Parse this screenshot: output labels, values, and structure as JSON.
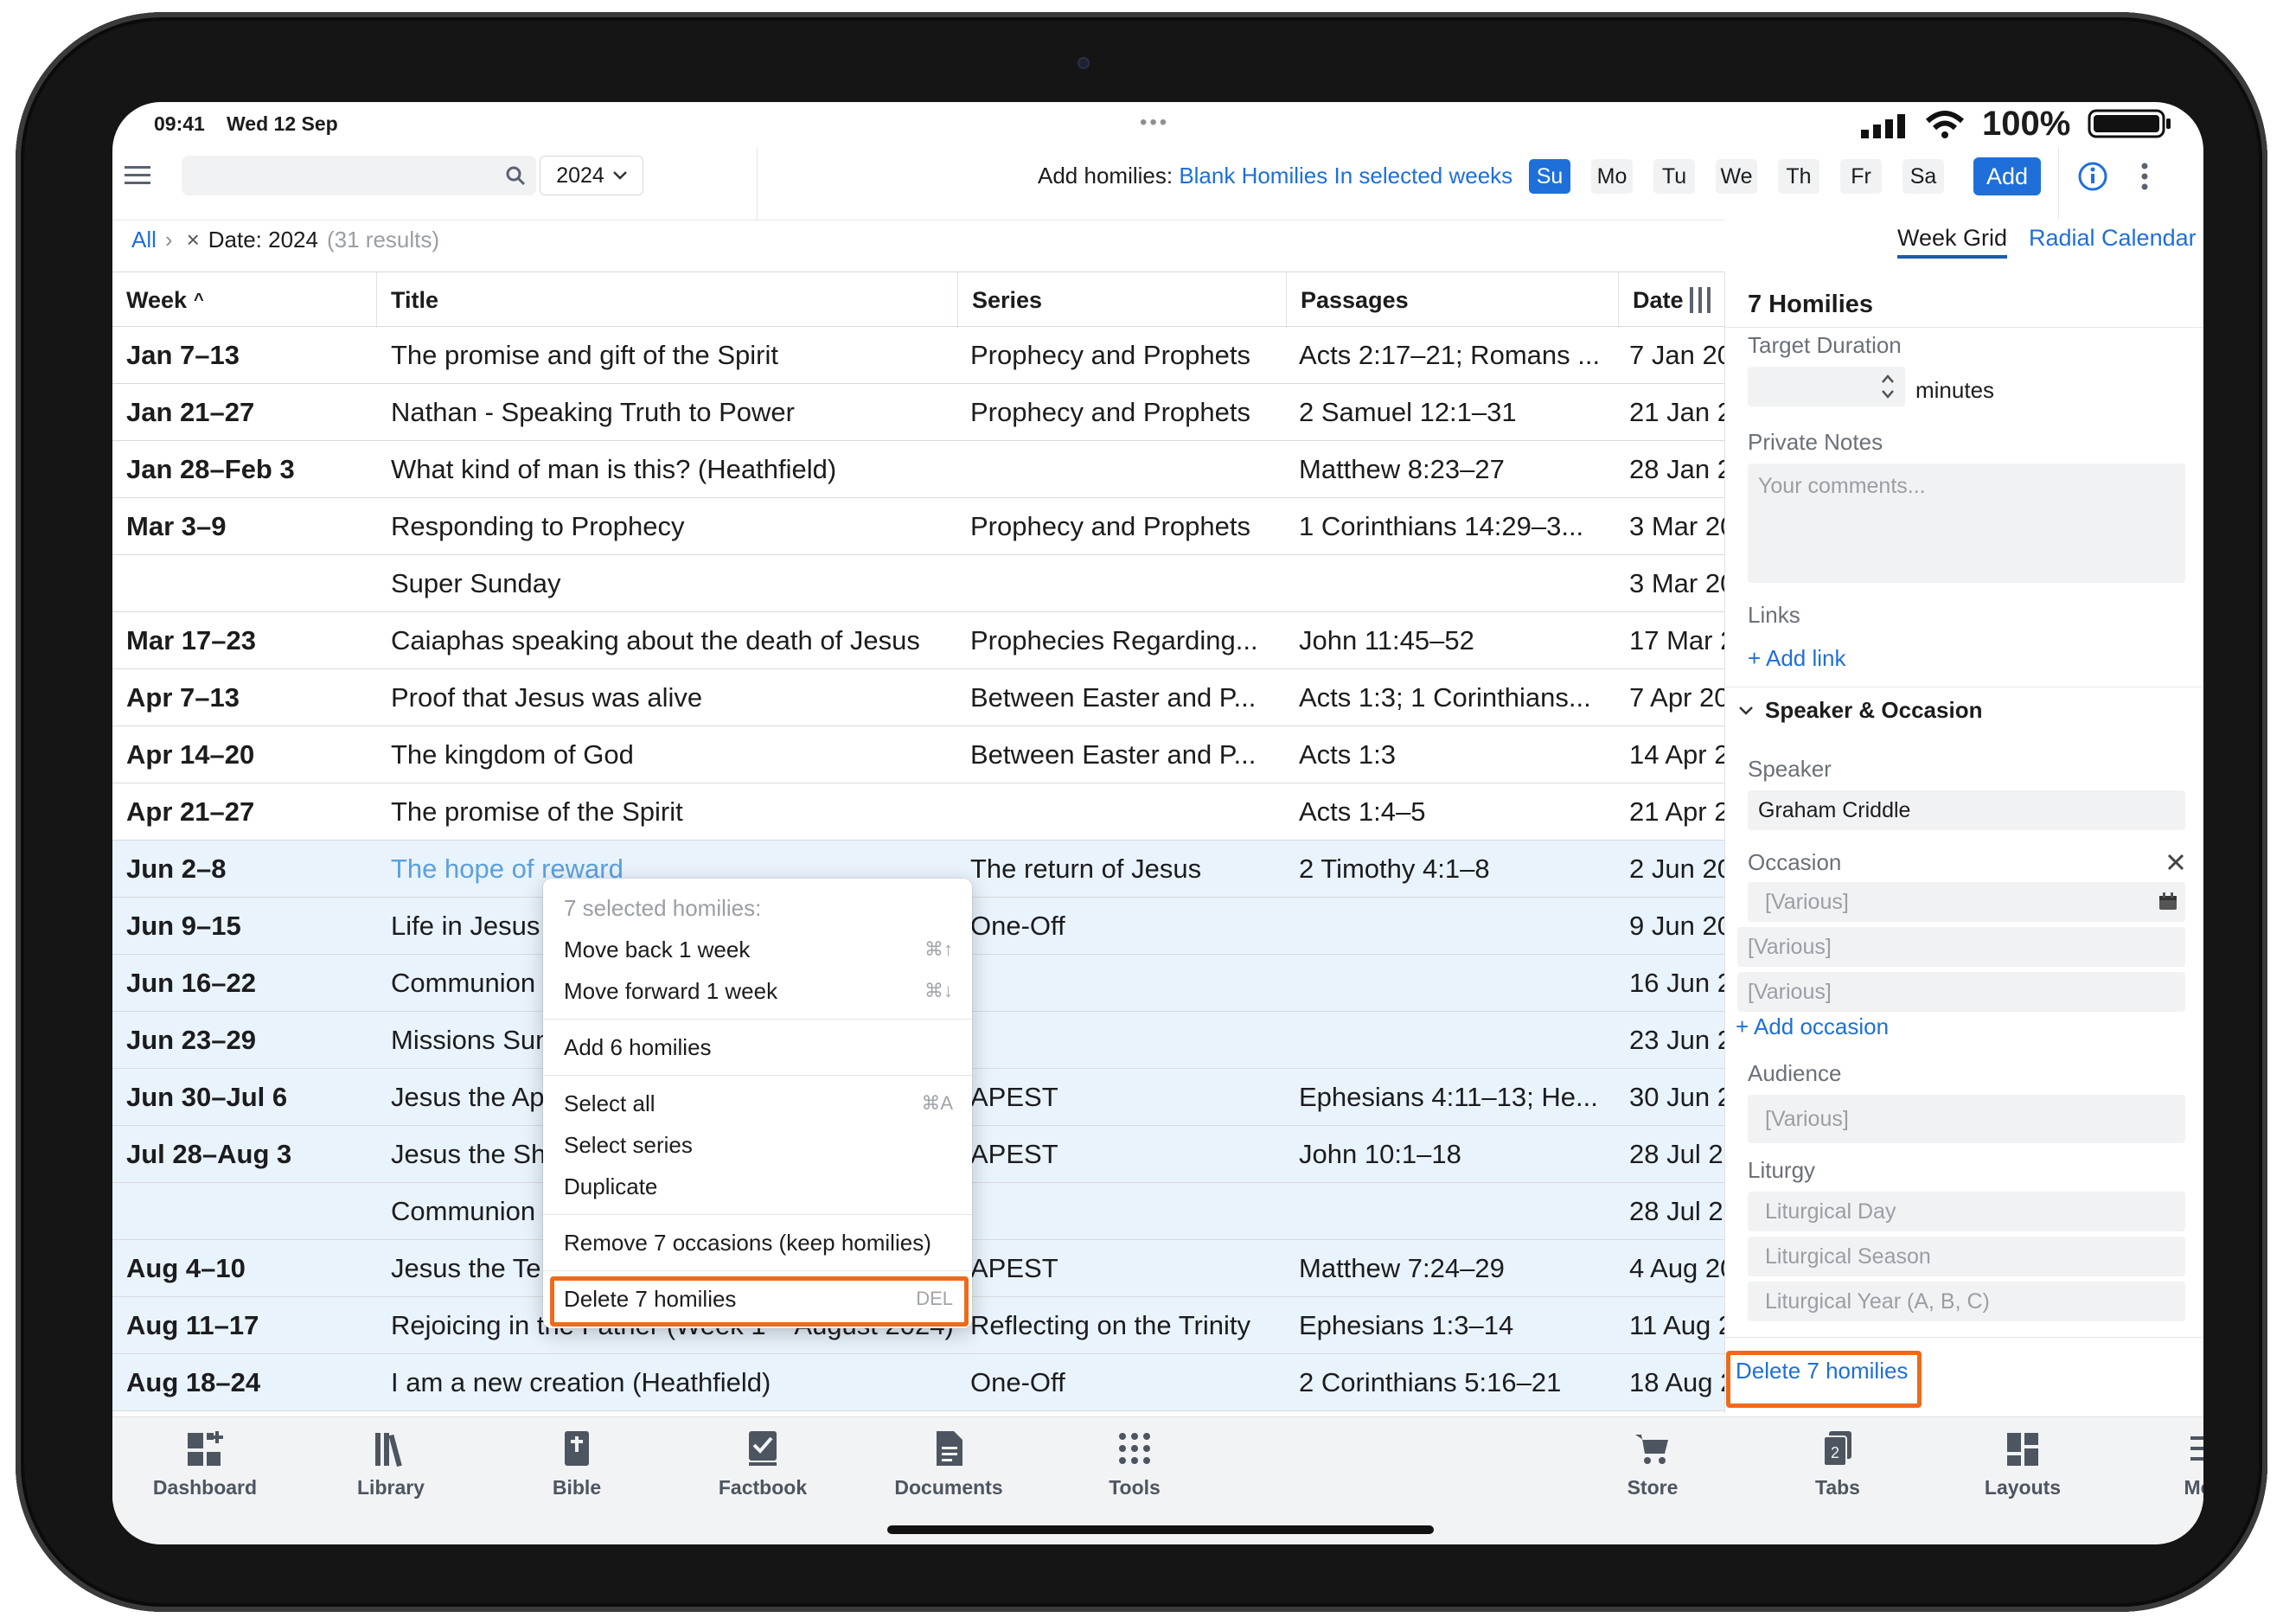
{
  "status": {
    "time": "09:41",
    "date": "Wed 12 Sep",
    "battery": "100%"
  },
  "toolbar": {
    "year": "2024",
    "add_label": "Add homilies:",
    "blank_link": "Blank Homilies",
    "weeks_link": "In selected weeks",
    "days": [
      "Su",
      "Mo",
      "Tu",
      "We",
      "Th",
      "Fr",
      "Sa"
    ],
    "add_button": "Add"
  },
  "filter": {
    "all": "All",
    "chevron": "›",
    "remove": "×",
    "date": "Date: 2024",
    "results": "(31 results)"
  },
  "views": {
    "week_grid": "Week Grid",
    "radial": "Radial Calendar"
  },
  "table": {
    "headers": {
      "week": "Week",
      "title": "Title",
      "series": "Series",
      "passages": "Passages",
      "date": "Date"
    },
    "rows": [
      {
        "week": "Jan 7–13",
        "title": "The promise and gift of the Spirit",
        "series": "Prophecy and Prophets",
        "passages": "Acts 2:17–21; Romans ...",
        "date": "7 Jan 20"
      },
      {
        "week": "Jan 21–27",
        "title": "Nathan - Speaking Truth to Power",
        "series": "Prophecy and Prophets",
        "passages": "2 Samuel 12:1–31",
        "date": "21 Jan 2"
      },
      {
        "week": "Jan 28–Feb 3",
        "title": "What kind of man is this? (Heathfield)",
        "series": "",
        "passages": "Matthew 8:23–27",
        "date": "28 Jan 2"
      },
      {
        "week": "Mar 3–9",
        "title": "Responding to Prophecy",
        "series": "Prophecy and Prophets",
        "passages": "1 Corinthians 14:29–3...",
        "date": "3 Mar 20"
      },
      {
        "week": "",
        "title": "Super Sunday",
        "series": "",
        "passages": "",
        "date": "3 Mar 20"
      },
      {
        "week": "Mar 17–23",
        "title": "Caiaphas speaking about the death of Jesus",
        "series": "Prophecies Regarding...",
        "passages": "John 11:45–52",
        "date": "17 Mar 2"
      },
      {
        "week": "Apr 7–13",
        "title": "Proof that Jesus was alive",
        "series": "Between Easter and P...",
        "passages": "Acts 1:3; 1 Corinthians...",
        "date": "7 Apr 20"
      },
      {
        "week": "Apr 14–20",
        "title": "The kingdom of God",
        "series": "Between Easter and P...",
        "passages": "Acts 1:3",
        "date": "14 Apr 2"
      },
      {
        "week": "Apr 21–27",
        "title": "The promise of the Spirit",
        "series": "",
        "passages": "Acts 1:4–5",
        "date": "21 Apr 2"
      },
      {
        "week": "Jun 2–8",
        "title": "The hope of reward",
        "series": "The return of Jesus",
        "passages": "2 Timothy 4:1–8",
        "date": "2 Jun 20"
      },
      {
        "week": "Jun 9–15",
        "title": "Life in Jesus",
        "series": "One-Off",
        "passages": "",
        "date": "9 Jun 20"
      },
      {
        "week": "Jun 16–22",
        "title": "Communion",
        "series": "",
        "passages": "",
        "date": "16 Jun 2"
      },
      {
        "week": "Jun 23–29",
        "title": "Missions Sun",
        "series": "",
        "passages": "",
        "date": "23 Jun 2"
      },
      {
        "week": "Jun 30–Jul 6",
        "title": "Jesus the Ap",
        "series": "APEST",
        "passages": "Ephesians 4:11–13; He...",
        "date": "30 Jun 2"
      },
      {
        "week": "Jul 28–Aug 3",
        "title": "Jesus the Sh",
        "series": "APEST",
        "passages": "John 10:1–18",
        "date": "28 Jul 2"
      },
      {
        "week": "",
        "title": "Communion",
        "series": "",
        "passages": "",
        "date": "28 Jul 2"
      },
      {
        "week": "Aug 4–10",
        "title": "Jesus the Te",
        "series": "APEST",
        "passages": "Matthew 7:24–29",
        "date": "4 Aug 20"
      },
      {
        "week": "Aug 11–17",
        "title": "Rejoicing in the Father (Week 1 – August 2024)",
        "series": "Reflecting on the Trinity",
        "passages": "Ephesians 1:3–14",
        "date": "11 Aug 2"
      },
      {
        "week": "Aug 18–24",
        "title": "I am a new creation (Heathfield)",
        "series": "One-Off",
        "passages": "2 Corinthians 5:16–21",
        "date": "18 Aug 2"
      }
    ]
  },
  "context_menu": {
    "header": "7 selected homilies:",
    "move_back": "Move back 1 week",
    "move_back_sc": "⌘↑",
    "move_forward": "Move forward 1 week",
    "move_forward_sc": "⌘↓",
    "add": "Add 6 homilies",
    "select_all": "Select all",
    "select_all_sc": "⌘A",
    "select_series": "Select series",
    "duplicate": "Duplicate",
    "remove_occ": "Remove 7 occasions (keep homilies)",
    "delete": "Delete 7 homilies",
    "delete_sc": "DEL"
  },
  "panel": {
    "title": "7 Homilies",
    "target_duration": "Target Duration",
    "minutes": "minutes",
    "private_notes": "Private Notes",
    "notes_placeholder": "Your comments...",
    "links": "Links",
    "add_link": "+ Add link",
    "speaker_occasion": "Speaker & Occasion",
    "speaker_label": "Speaker",
    "speaker_value": "Graham Criddle",
    "occasion_label": "Occasion",
    "occasions": [
      "[Various]",
      "[Various]",
      "[Various]"
    ],
    "add_occasion": "+ Add occasion",
    "audience_label": "Audience",
    "audience_value": "[Various]",
    "liturgy_label": "Liturgy",
    "liturgical_day": "Liturgical Day",
    "liturgical_season": "Liturgical Season",
    "liturgical_year": "Liturgical Year (A, B, C)",
    "delete_link": "Delete 7 homilies"
  },
  "tabs": [
    {
      "label": "Dashboard",
      "icon": "dashboard-icon"
    },
    {
      "label": "Library",
      "icon": "library-icon"
    },
    {
      "label": "Bible",
      "icon": "bible-icon"
    },
    {
      "label": "Factbook",
      "icon": "factbook-icon"
    },
    {
      "label": "Documents",
      "icon": "documents-icon"
    },
    {
      "label": "Tools",
      "icon": "tools-icon"
    },
    {
      "label": "Store",
      "icon": "store-icon"
    },
    {
      "label": "Tabs",
      "icon": "tabs-icon"
    },
    {
      "label": "Layouts",
      "icon": "layouts-icon"
    },
    {
      "label": "More",
      "icon": "more-icon"
    }
  ],
  "colors": {
    "accent": "#1e6fd9",
    "highlight": "#ec6b1c",
    "selected_row": "#e9f3fc"
  }
}
